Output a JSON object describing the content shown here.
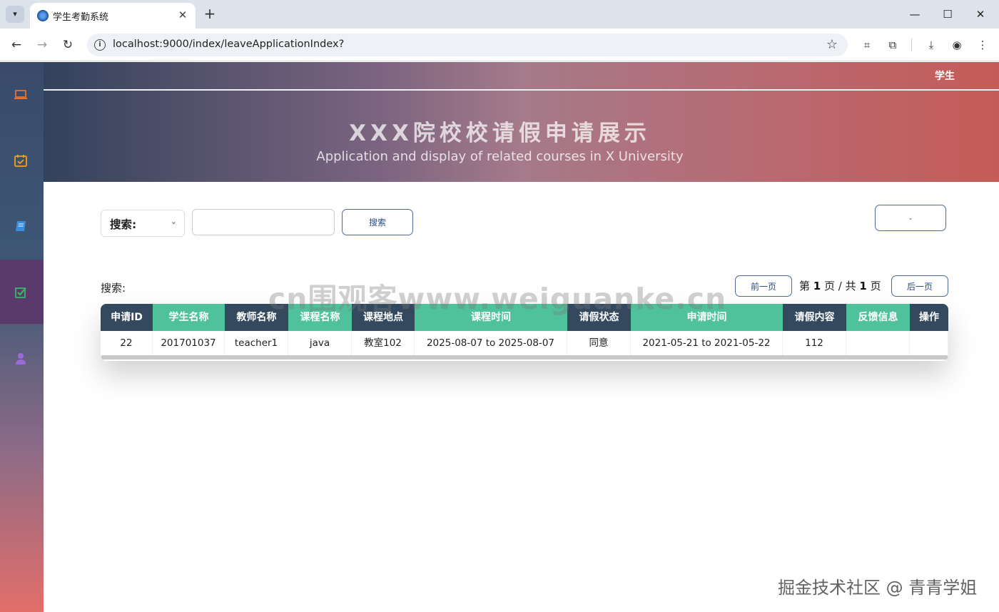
{
  "browser": {
    "tab_title": "学生考勤系统",
    "url": "localhost:9000/index/leaveApplicationIndex?"
  },
  "header": {
    "role": "学生",
    "title": "XXX院校校请假申请展示",
    "subtitle": "Application and display of related courses in X University"
  },
  "sidebar": {
    "items": [
      {
        "icon": "laptop-icon",
        "color": "#e8702a"
      },
      {
        "icon": "calendar-check-icon",
        "color": "#f0a020"
      },
      {
        "icon": "book-icon",
        "color": "#3a8ee0"
      },
      {
        "icon": "checkbox-icon",
        "color": "#3ab56a",
        "active": true
      },
      {
        "icon": "user-icon",
        "color": "#9a6ad8"
      }
    ]
  },
  "search": {
    "select_label": "搜索:",
    "input_value": "",
    "button_label": "搜索",
    "dash_button_label": "-"
  },
  "pager": {
    "search_label": "搜索:",
    "prev_label": "前一页",
    "next_label": "后一页",
    "page_prefix": "第 ",
    "current_page": "1",
    "page_mid": " 页 / 共 ",
    "total_pages": "1",
    "page_suffix": " 页"
  },
  "table": {
    "columns": [
      "申请ID",
      "学生名称",
      "教师名称",
      "课程名称",
      "课程地点",
      "课程时间",
      "请假状态",
      "申请时间",
      "请假内容",
      "反馈信息",
      "操作"
    ],
    "rows": [
      [
        "22",
        "201701037",
        "teacher1",
        "java",
        "教室102",
        "2025-08-07 to 2025-08-07",
        "同意",
        "2021-05-21 to 2021-05-22",
        "112",
        "",
        ""
      ]
    ]
  },
  "watermarks": {
    "center": "cn围观客www.weiguanke.cn",
    "corner": "掘金技术社区 @ 青青学姐"
  },
  "colors": {
    "header_dark": "#34495e",
    "header_green": "#4fc29b",
    "button_border": "#4a6aa0"
  }
}
